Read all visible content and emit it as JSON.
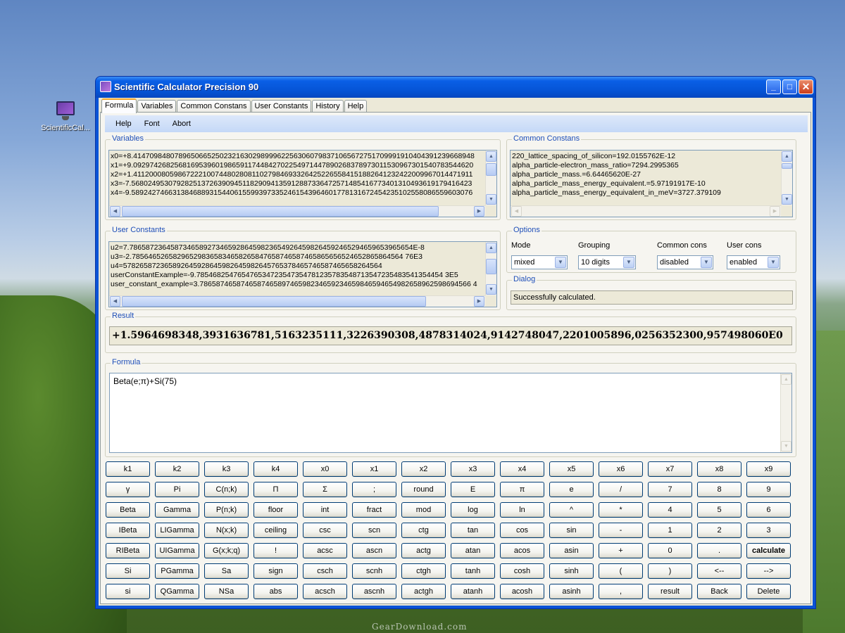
{
  "desktop": {
    "icon_label": "ScientificCal...",
    "watermark": "GearDownload.com"
  },
  "window": {
    "title": "Scientific Calculator Precision 90",
    "controls": {
      "minimize": "_",
      "maximize": "□",
      "close": "✕"
    }
  },
  "tabs": [
    "Formula",
    "Variables",
    "Common Constans",
    "User Constants",
    "History",
    "Help"
  ],
  "menu": [
    "Help",
    "Font",
    "Abort"
  ],
  "variables": {
    "title": "Variables",
    "lines": [
      "x0=+8.41470984807896506652502321630298999622563060798371065672751709991910404391239668948",
      "x1=+9.09297426825681695396019865911744842702254971447890268378973011530967301540783544620",
      "x2=+1.41120008059867222100744802808110279846933264252265584151882641232422009967014471911",
      "x3=-7.56802495307928251372639094511829094135912887336472571485416773401310493619179416423",
      "x4=-9.58924274663138468893154406155993973352461543964601778131672454235102558086559603076"
    ]
  },
  "common_constants": {
    "title": "Common Constans",
    "lines": [
      "220_lattice_spacing_of_silicon=192.0155762E-12",
      "alpha_particle-electron_mass_ratio=7294.2995365",
      "alpha_particle_mass.=6.64465620E-27",
      "alpha_particle_mass_energy_equivalent.=5.97191917E-10",
      "alpha_particle_mass_energy_equivalent_in_meV=3727.379109"
    ]
  },
  "user_constants": {
    "title": "User Constants",
    "lines": [
      "u2=7.786587236458734658927346592864598236549264598264592465294659653965654E-8",
      "u3=-2.785646526582965298365834658265847658746587465865656524652865864564 76E3",
      "u4=578265872365892645928645982645982645765378465746587465658264564",
      "userConstantExample=-9.785468254765476534723547354781235783548713547235483541354454 3E5",
      "user_constant_example=3.786587465874658746589746598234659234659846594654982658962598694566 4"
    ]
  },
  "options": {
    "title": "Options",
    "fields": [
      {
        "label": "Mode",
        "value": "mixed"
      },
      {
        "label": "Grouping",
        "value": "10 digits"
      },
      {
        "label": "Common cons",
        "value": "disabled"
      },
      {
        "label": "User cons",
        "value": "enabled"
      }
    ]
  },
  "dialog": {
    "title": "Dialog",
    "message": "Successfully calculated."
  },
  "result": {
    "title": "Result",
    "value": "+1.5964698348,3931636781,5163235111,3226390308,4878314024,9142748047,2201005896,0256352300,957498060E0"
  },
  "formula": {
    "title": "Formula",
    "value": "Beta(e;π)+Si(75)"
  },
  "keypad": [
    [
      "k1",
      "k2",
      "k3",
      "k4",
      "x0",
      "x1",
      "x2",
      "x3",
      "x4",
      "x5",
      "x6",
      "x7",
      "x8",
      "x9"
    ],
    [
      "γ",
      "Pi",
      "C(n;k)",
      "Π",
      "Σ",
      ";",
      "round",
      "E",
      "π",
      "e",
      "/",
      "7",
      "8",
      "9"
    ],
    [
      "Beta",
      "Gamma",
      "P(n;k)",
      "floor",
      "int",
      "fract",
      "mod",
      "log",
      "ln",
      "^",
      "*",
      "4",
      "5",
      "6"
    ],
    [
      "IBeta",
      "LIGamma",
      "N(x;k)",
      "ceiling",
      "csc",
      "scn",
      "ctg",
      "tan",
      "cos",
      "sin",
      "-",
      "1",
      "2",
      "3"
    ],
    [
      "RIBeta",
      "UIGamma",
      "G(x;k;q)",
      "!",
      "acsc",
      "ascn",
      "actg",
      "atan",
      "acos",
      "asin",
      "+",
      "0",
      ".",
      "calculate"
    ],
    [
      "Si",
      "PGamma",
      "Sa",
      "sign",
      "csch",
      "scnh",
      "ctgh",
      "tanh",
      "cosh",
      "sinh",
      "(",
      ")",
      "<--",
      "-->"
    ],
    [
      "si",
      "QGamma",
      "NSa",
      "abs",
      "acsch",
      "ascnh",
      "actgh",
      "atanh",
      "acosh",
      "asinh",
      ",",
      "result",
      "Back",
      "Delete"
    ]
  ]
}
